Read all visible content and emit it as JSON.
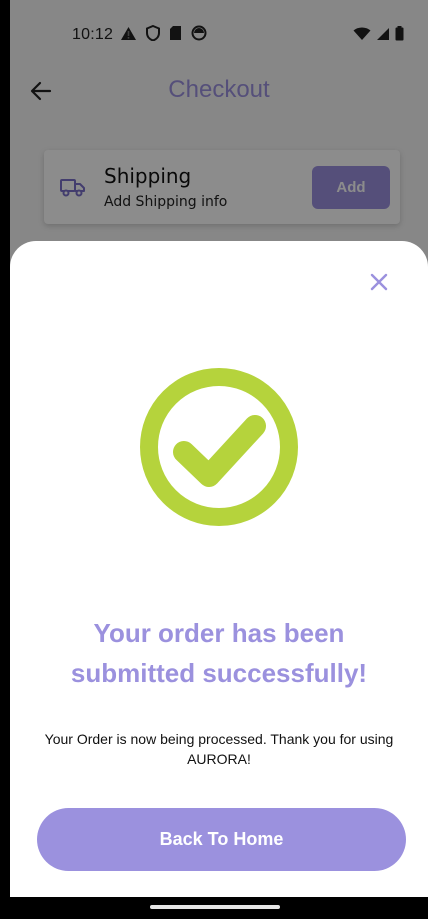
{
  "status_bar": {
    "time": "10:12",
    "left_icons": [
      "warning-icon",
      "shield-icon",
      "sim-icon",
      "circle-icon"
    ],
    "right_icons": [
      "wifi-icon",
      "signal-icon",
      "battery-icon"
    ]
  },
  "app_bar": {
    "title": "Checkout"
  },
  "shipping": {
    "title": "Shipping",
    "subtitle": "Add Shipping info",
    "add_label": "Add"
  },
  "sheet": {
    "title": "Your order has been submitted successfully!",
    "message": "Your Order is now being processed. Thank you for using AURORA!",
    "button_label": "Back To Home"
  },
  "colors": {
    "accent": "#9b91de",
    "success": "#b5d33c"
  }
}
